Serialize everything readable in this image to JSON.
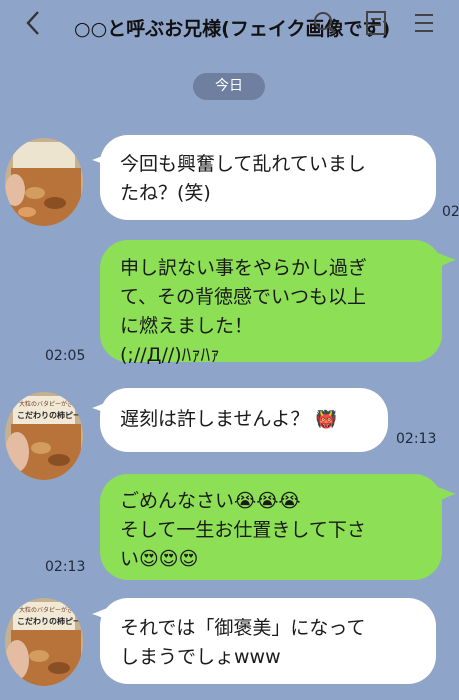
{
  "header": {
    "title": "○○と呼ぶお兄様(フェイク画像です)",
    "back_icon": "chevron-left-icon",
    "search_icon": "search-icon",
    "note_icon": "notes-icon",
    "menu_icon": "menu-icon"
  },
  "date_separator": "今日",
  "messages": [
    {
      "side": "incoming",
      "lines": [
        "今回も興奮して乱れていまし",
        "たね？(笑)"
      ],
      "time": "02"
    },
    {
      "side": "outgoing",
      "lines": [
        "申し訳ない事をやらかし過ぎ",
        "て、その背徳感でいつも以上",
        "に燃えました！",
        "(;//Д//)ﾊｧﾊｧ"
      ],
      "time": "02:05"
    },
    {
      "side": "incoming",
      "lines": [
        "遅刻は許しませんよ？"
      ],
      "emoji": "👹",
      "time": "02:13"
    },
    {
      "side": "outgoing",
      "lines": [
        "ごめんなさい😭😭😭",
        "そして一生お仕置きして下さ",
        "い😍😍😍"
      ],
      "time": "02:13"
    },
    {
      "side": "incoming",
      "lines": [
        "それでは「御褒美」になって",
        "しまうでしょwww"
      ],
      "time": ""
    }
  ],
  "avatar": {
    "label_line1": "大粒のバタピーがぎ",
    "label_line2": "こだわりの柿ピー"
  },
  "colors": {
    "background": "#8ea4c9",
    "incoming_bubble": "#ffffff",
    "outgoing_bubble": "#8de055",
    "date_pill": "#6e7fa0"
  }
}
